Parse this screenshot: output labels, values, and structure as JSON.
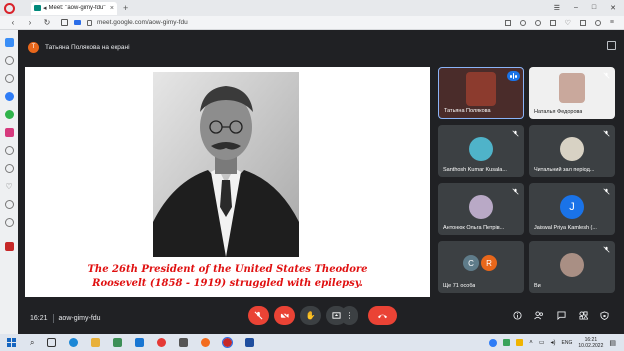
{
  "browser": {
    "tab_title": "Meet: \"aow-gimy-fdu\"",
    "url": "meet.google.com/aow-gimy-fdu"
  },
  "meet": {
    "presenter_initial": "T",
    "presenting_text": "Татьяна Полякова на екрані",
    "slide_caption_line1": "The 26th President of the United States Theodore",
    "slide_caption_line2": "Roosevelt (1858 - 1919) struggled with epilepsy.",
    "participants": [
      {
        "name": "Татьяна Полякова",
        "speaking": true
      },
      {
        "name": "Наталья Федорова",
        "muted": true
      },
      {
        "name": "Santhosh Kumar Kusala...",
        "muted": true
      },
      {
        "name": "Читальний зал період...",
        "muted": true
      },
      {
        "name": "Антонюк Ольга Петрів...",
        "muted": true
      },
      {
        "name": "Jaiswal Priya Kamlesh (...",
        "muted": true,
        "initial": "J"
      },
      {
        "name": "Ще 71 особа",
        "initials": [
          "C",
          "R"
        ]
      },
      {
        "name": "Ви",
        "muted": true
      }
    ],
    "time": "16:21",
    "meeting_code": "aow-gimy-fdu",
    "colors": {
      "mic_off": "#ea4335",
      "hangup": "#ea4335",
      "accent_blue": "#1a73e8",
      "bg": "#202124",
      "tile": "#3c4043"
    }
  },
  "taskbar": {
    "language": "ENG",
    "clock_time": "16:21",
    "clock_date": "10.02.2022"
  }
}
